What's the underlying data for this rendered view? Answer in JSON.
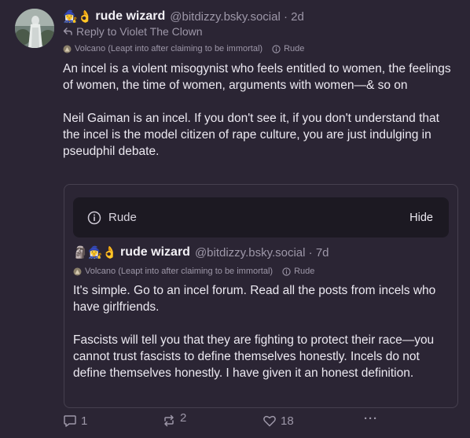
{
  "post": {
    "emoji": "🧙‍♀️👌",
    "author_name": "rude wizard",
    "author_handle": "@bitdizzy.bsky.social",
    "time": "2d",
    "reply_to": "Reply to Violet The Clown",
    "labels": [
      {
        "text": "Volcano (Leapt into after claiming to be immortal)",
        "icon": "volcano-icon"
      },
      {
        "text": "Rude",
        "icon": "info-icon"
      }
    ],
    "paragraphs": [
      "An incel is a violent misogynist who feels entitled to women, the feelings of women, the time of women, arguments with women—& so on",
      "Neil Gaiman is an incel. If you don't see it, if you don't understand that the incel is the model citizen of rape culture, you are just indulging in pseudphil debate."
    ]
  },
  "quote": {
    "warning_label": "Rude",
    "hide_label": "Hide",
    "emoji": "🗿🧙‍♀️👌",
    "author_name": "rude wizard",
    "author_handle": "@bitdizzy.bsky.social",
    "time": "7d",
    "labels": [
      {
        "text": "Volcano (Leapt into after claiming to be immortal)",
        "icon": "volcano-icon"
      },
      {
        "text": "Rude",
        "icon": "info-icon"
      }
    ],
    "paragraphs": [
      "It's simple. Go to an incel forum. Read all the posts from incels who have girlfriends.",
      "Fascists will tell you that they are fighting to protect their race—you cannot trust fascists to define themselves honestly. Incels do not define themselves honestly. I have given it an honest definition."
    ]
  },
  "actions": {
    "replies": "1",
    "reposts": "2",
    "likes": "18",
    "more": "···"
  },
  "colors": {
    "background": "#2b2534",
    "text": "#ece9f1",
    "muted": "#9d97a8",
    "warning_bg": "#1c1922",
    "border": "#46404f"
  }
}
